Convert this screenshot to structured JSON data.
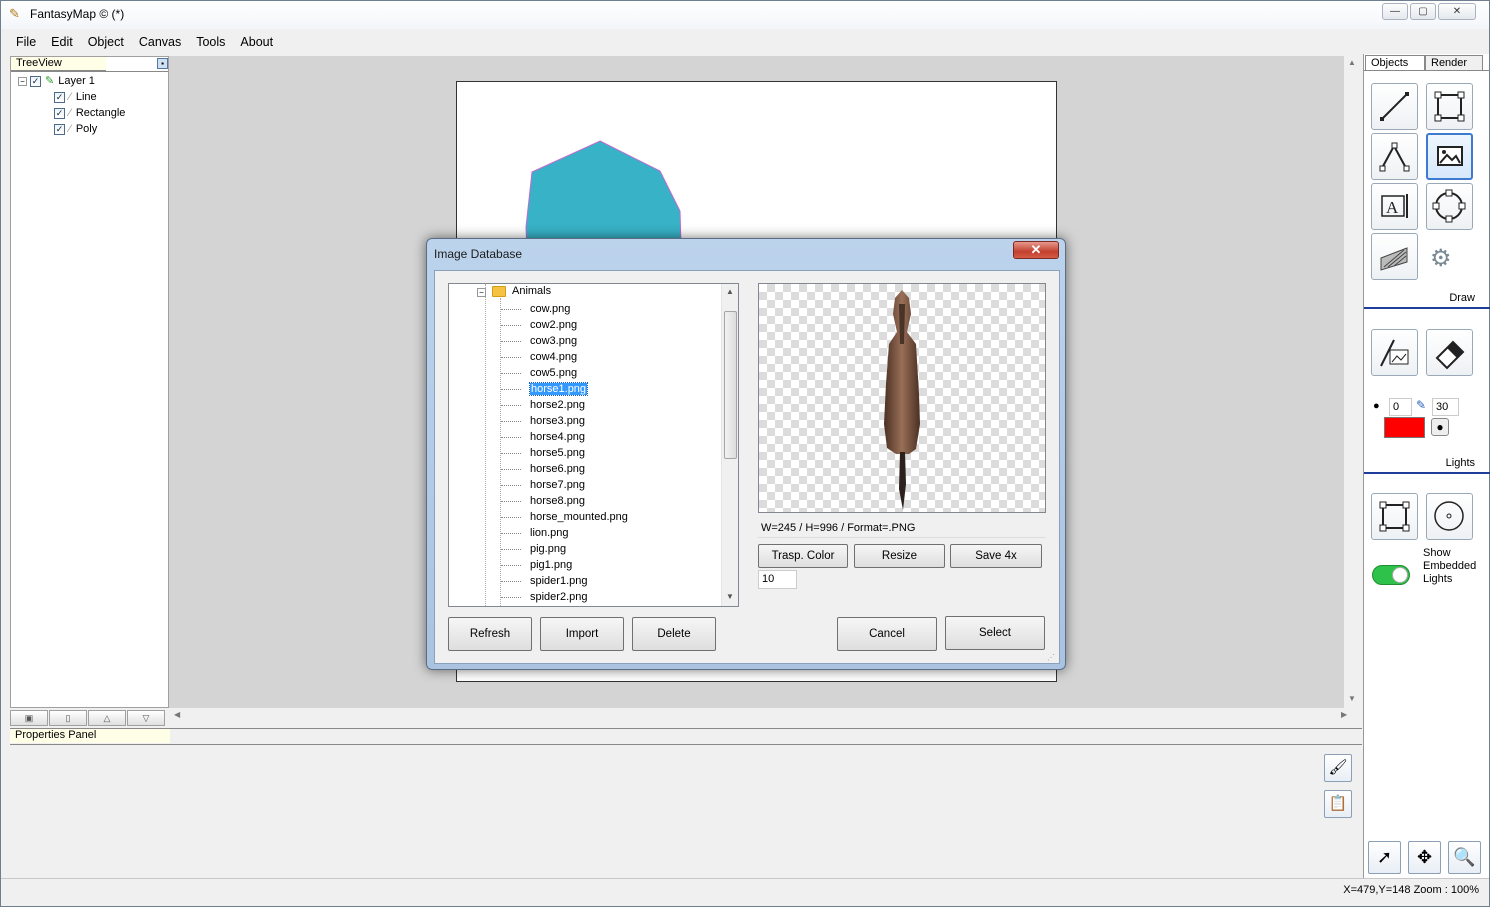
{
  "window": {
    "title": "FantasyMap © (*)",
    "controls": {
      "minimize": "—",
      "maximize": "▢",
      "close": "✕"
    }
  },
  "menu": {
    "items": [
      "File",
      "Edit",
      "Object",
      "Canvas",
      "Tools",
      "About"
    ]
  },
  "treeview": {
    "header": "TreeView",
    "layer": {
      "label": "Layer 1",
      "checked": true
    },
    "children": [
      {
        "label": "Line",
        "checked": true
      },
      {
        "label": "Rectangle",
        "checked": true
      },
      {
        "label": "Poly",
        "checked": true
      }
    ]
  },
  "canvas": {
    "shape_color": "#38b2c6"
  },
  "properties": {
    "header": "Properties Panel"
  },
  "right_panel": {
    "tabs": [
      "Objects",
      "Render"
    ],
    "draw_label": "Draw",
    "lights_label": "Lights",
    "brush_size": "0",
    "brush_width": "30",
    "brush_color": "#ff0000",
    "show_embedded_lights": "Show Embedded Lights",
    "lights_toggle_on": true,
    "accent_color": "#1f3d9a"
  },
  "status": {
    "text": "X=479,Y=148  Zoom : 100%"
  },
  "dialog": {
    "title": "Image Database",
    "close": "✕",
    "folder": "Animals",
    "files": [
      "cow.png",
      "cow2.png",
      "cow3.png",
      "cow4.png",
      "cow5.png",
      "horse1.png",
      "horse2.png",
      "horse3.png",
      "horse4.png",
      "horse5.png",
      "horse6.png",
      "horse7.png",
      "horse8.png",
      "horse_mounted.png",
      "lion.png",
      "pig.png",
      "pig1.png",
      "spider1.png",
      "spider2.png"
    ],
    "selected_index": 5,
    "image_info": "W=245 / H=996 / Format=.PNG",
    "buttons": {
      "transp_color": "Trasp. Color",
      "resize": "Resize",
      "save4x": "Save 4x",
      "refresh": "Refresh",
      "import": "Import",
      "delete": "Delete",
      "cancel": "Cancel",
      "select": "Select"
    },
    "tolerance": "10"
  }
}
